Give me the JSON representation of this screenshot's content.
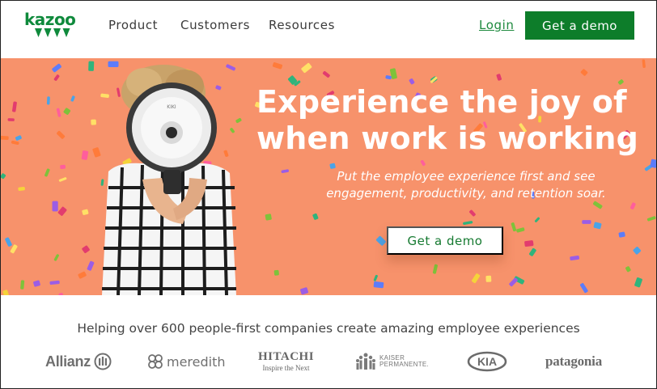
{
  "brand": {
    "logo_text": "kazoo",
    "logo_color": "#0f8a3c"
  },
  "nav": {
    "items": [
      {
        "label": "Product"
      },
      {
        "label": "Customers"
      },
      {
        "label": "Resources"
      }
    ],
    "login_label": "Login",
    "demo_label": "Get a demo"
  },
  "hero": {
    "background_color": "#f7926b",
    "headline_line1": "Experience the joy of",
    "headline_line2": "when work is working",
    "subline_line1": "Put the employee experience first and see",
    "subline_line2": "engagement, productivity, and retention soar.",
    "cta_label": "Get a demo",
    "megaphone_label": "KIKI"
  },
  "customers": {
    "tagline": "Helping over 600 people-first companies create amazing employee experiences",
    "logos": {
      "allianz": "Allianz",
      "meredith": "meredith",
      "hitachi": "HITACHI",
      "hitachi_sub": "Inspire the Next",
      "kaiser_line1": "KAISER",
      "kaiser_line2": "PERMANENTE.",
      "kia": "KIA",
      "patagonia": "patagonia"
    }
  },
  "colors": {
    "primary_green": "#0d7d2a",
    "link_green": "#1e8a3e",
    "hero_orange": "#f7926b"
  }
}
